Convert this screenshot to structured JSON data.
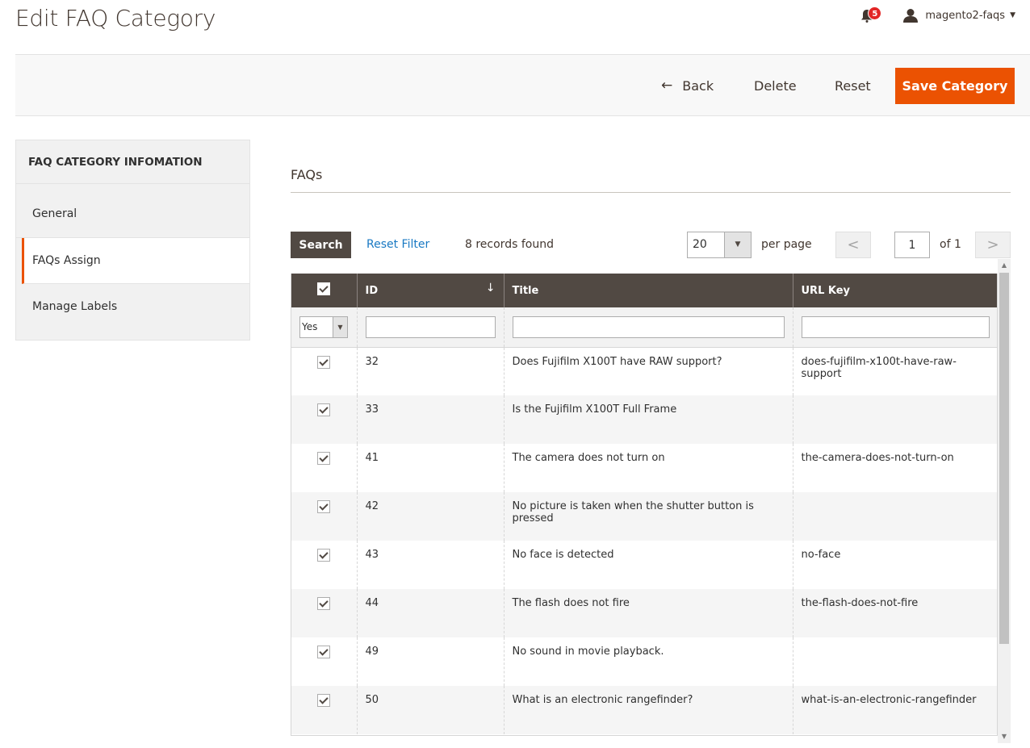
{
  "header": {
    "title": "Edit FAQ Category",
    "notifications_count": "5",
    "username": "magento2-faqs"
  },
  "actions": {
    "back": "Back",
    "delete": "Delete",
    "reset": "Reset",
    "save": "Save Category"
  },
  "colors": {
    "accent": "#eb5202",
    "header_dark": "#514943",
    "link": "#1979c3",
    "badge": "#e22626"
  },
  "sidebar": {
    "title": "FAQ CATEGORY INFOMATION",
    "items": [
      {
        "label": "General",
        "active": false
      },
      {
        "label": "FAQs Assign",
        "active": true
      },
      {
        "label": "Manage Labels",
        "active": false
      }
    ]
  },
  "section": {
    "title": "FAQs"
  },
  "toolbar": {
    "search": "Search",
    "reset_filter": "Reset Filter",
    "records_found": "8 records found",
    "per_page_value": "20",
    "per_page_label": "per page",
    "page_value": "1",
    "page_of": "of 1"
  },
  "grid": {
    "columns": [
      "",
      "ID",
      "Title",
      "URL Key"
    ],
    "filter_select_value": "Yes",
    "rows": [
      {
        "checked": true,
        "id": "32",
        "title": "Does Fujifilm X100T have RAW support?",
        "url_key": "does-fujifilm-x100t-have-raw-support"
      },
      {
        "checked": true,
        "id": "33",
        "title": "Is the Fujifilm X100T Full Frame",
        "url_key": ""
      },
      {
        "checked": true,
        "id": "41",
        "title": "The camera does not turn on",
        "url_key": "the-camera-does-not-turn-on"
      },
      {
        "checked": true,
        "id": "42",
        "title": "No picture is taken when the shutter button is pressed",
        "url_key": ""
      },
      {
        "checked": true,
        "id": "43",
        "title": "No face is detected",
        "url_key": "no-face"
      },
      {
        "checked": true,
        "id": "44",
        "title": "The flash does not fire",
        "url_key": "the-flash-does-not-fire"
      },
      {
        "checked": true,
        "id": "49",
        "title": "No sound in movie playback.",
        "url_key": ""
      },
      {
        "checked": true,
        "id": "50",
        "title": "What is an electronic rangefinder?",
        "url_key": "what-is-an-electronic-rangefinder"
      }
    ]
  }
}
